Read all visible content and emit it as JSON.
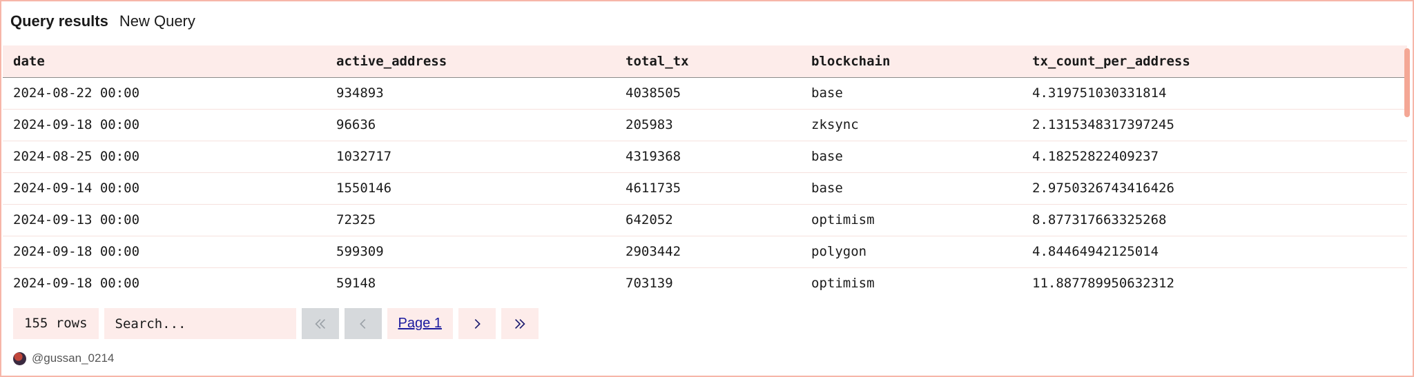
{
  "header": {
    "title": "Query results",
    "subtitle": "New Query"
  },
  "table": {
    "columns": [
      "date",
      "active_address",
      "total_tx",
      "blockchain",
      "tx_count_per_address"
    ],
    "rows": [
      [
        "2024-08-22 00:00",
        "934893",
        "4038505",
        "base",
        "4.319751030331814"
      ],
      [
        "2024-09-18 00:00",
        "96636",
        "205983",
        "zksync",
        "2.1315348317397245"
      ],
      [
        "2024-08-25 00:00",
        "1032717",
        "4319368",
        "base",
        "4.18252822409237"
      ],
      [
        "2024-09-14 00:00",
        "1550146",
        "4611735",
        "base",
        "2.9750326743416426"
      ],
      [
        "2024-09-13 00:00",
        "72325",
        "642052",
        "optimism",
        "8.877317663325268"
      ],
      [
        "2024-09-18 00:00",
        "599309",
        "2903442",
        "polygon",
        "4.84464942125014"
      ],
      [
        "2024-09-18 00:00",
        "59148",
        "703139",
        "optimism",
        "11.887789950632312"
      ]
    ]
  },
  "pagination": {
    "rows_label": "155 rows",
    "search_placeholder": "Search...",
    "page_label": "Page 1"
  },
  "footer": {
    "username": "@gussan_0214"
  },
  "colors": {
    "accent_bg": "#fdecea",
    "border": "#f6b6a8",
    "scroll_thumb": "#f4a795",
    "disabled_btn": "#d6d9dc",
    "link": "#1a1a9e"
  }
}
